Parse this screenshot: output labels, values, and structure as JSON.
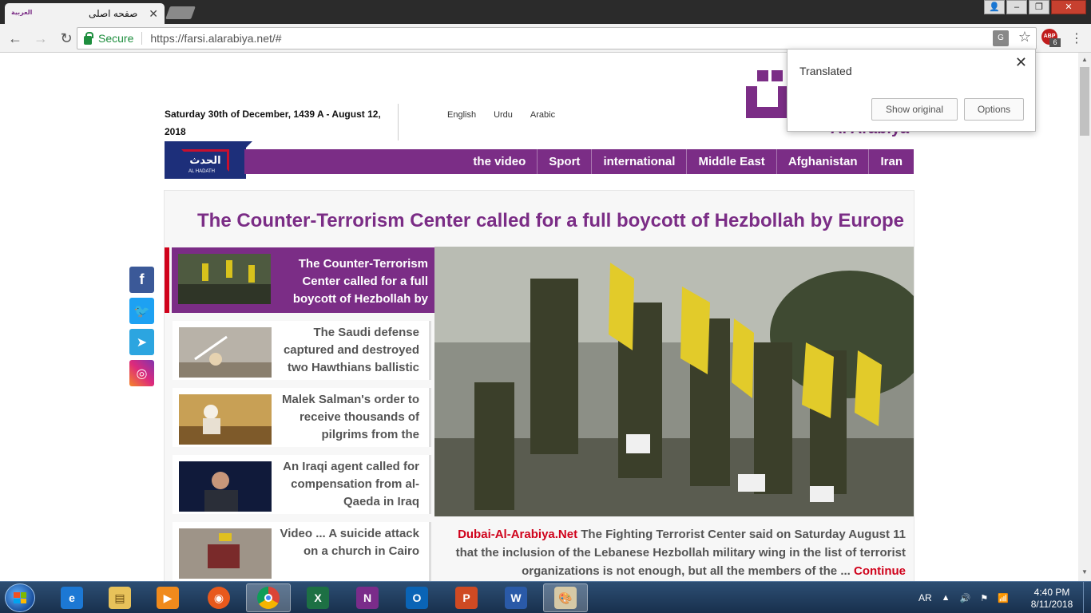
{
  "browser": {
    "tab_title": "صفحه اصلی",
    "tab_favicon_text": "العربية",
    "secure_label": "Secure",
    "url_scheme": "https://",
    "url_host": "farsi.alarabiya.net",
    "url_path": "/#",
    "abp_label": "ABP",
    "abp_badge": "6"
  },
  "translate_popup": {
    "title": "Translated",
    "show_original": "Show original",
    "options": "Options"
  },
  "header": {
    "date": "Saturday 30th of December, 1439 A - August 12, 2018",
    "languages": [
      "English",
      "Urdu",
      "Arabic"
    ],
    "logo_text": "Al Arabiya",
    "alhadath_label": "الحدث",
    "alhadath_sub": "AL HADATH"
  },
  "nav": {
    "items": [
      "the video",
      "Sport",
      "international",
      "Middle East",
      "Afghanistan",
      "Iran"
    ]
  },
  "main": {
    "headline": "The Counter-Terrorism Center called for a full boycott of Hezbollah by Europe",
    "stories": [
      {
        "text": "The Counter-Terrorism Center called for a full boycott of Hezbollah by"
      },
      {
        "text": "The Saudi defense captured and destroyed two Hawthians ballistic"
      },
      {
        "text": "Malek Salman's order to receive thousands of pilgrims from the"
      },
      {
        "text": "An Iraqi agent called for compensation from al-Qaeda in Iraq"
      },
      {
        "text": "Video ... A suicide attack on a church in Cairo"
      }
    ],
    "caption_source": "Dubai-Al-Arabiya.Net",
    "caption_text": "The Fighting Terrorist Center said on Saturday August 11 that the inclusion of the Lebanese Hezbollah military wing in the list of terrorist organizations is not enough, but all the members of the ...",
    "caption_more": "Continue"
  },
  "social": [
    "facebook",
    "twitter",
    "telegram",
    "instagram"
  ],
  "taskbar": {
    "apps": [
      "internet-explorer",
      "file-explorer",
      "media-player",
      "firefox",
      "chrome",
      "excel",
      "onenote",
      "outlook",
      "powerpoint",
      "word",
      "paint"
    ],
    "language": "AR",
    "time": "4:40 PM",
    "date": "8/11/2018"
  },
  "colors": {
    "brand_purple": "#7b2d86",
    "accent_red": "#d0021b",
    "alhadath_blue": "#1d2f7a"
  }
}
